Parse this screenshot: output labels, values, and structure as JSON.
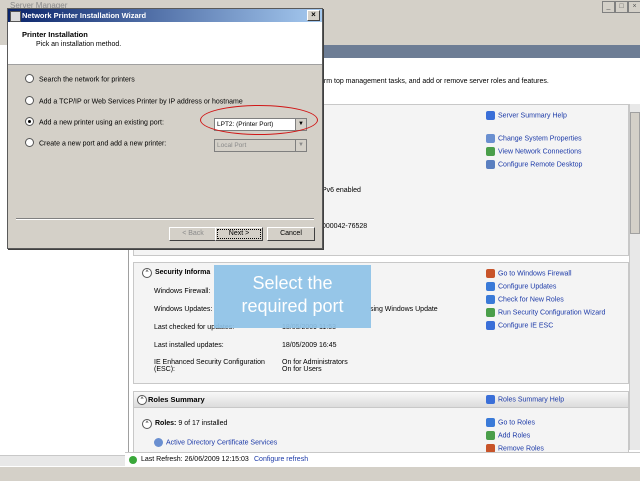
{
  "server_manager": {
    "window_title": "Server Manager",
    "intro_text": "orm top management tasks, and add or remove server roles and features.",
    "computer_info_fragments": {
      "ipv6": "Pv6 enabled",
      "product_id": "000042-76528"
    },
    "summary_links": {
      "help": "Server Summary Help",
      "items": [
        "Change System Properties",
        "View Network Connections",
        "Configure Remote Desktop"
      ]
    },
    "security": {
      "title": "Security Informa",
      "rows": [
        {
          "label": "Windows Firewall:",
          "value": ""
        },
        {
          "label": "Windows Updates:",
          "value": "sing Windows Update"
        },
        {
          "label": "Last checked for updates:",
          "value": "18/05/2009 11:53"
        },
        {
          "label": "Last installed updates:",
          "value": "18/05/2009 16:45"
        },
        {
          "label": "IE Enhanced Security Configuration (ESC):",
          "value": "On for Administrators On for Users"
        }
      ],
      "links": [
        "Go to Windows Firewall",
        "Configure Updates",
        "Check for New Roles",
        "Run Security Configuration Wizard",
        "Configure IE ESC"
      ]
    },
    "roles": {
      "title": "Roles Summary",
      "help": "Roles Summary Help",
      "count_label": "Roles:",
      "count_value": "9 of 17 installed",
      "first_role": "Active Directory Certificate Services",
      "links": [
        "Go to Roles",
        "Add Roles",
        "Remove Roles"
      ]
    },
    "status": {
      "last_refresh": "Last Refresh: 26/06/2009 12:15:03",
      "configure": "Configure refresh"
    }
  },
  "wizard": {
    "title": "Network Printer Installation Wizard",
    "header": "Printer Installation",
    "subheader": "Pick an installation method.",
    "options": [
      {
        "label": "Search the network for printers",
        "selected": false
      },
      {
        "label": "Add a TCP/IP or Web Services Printer by IP address or hostname",
        "selected": false
      },
      {
        "label": "Add a new printer using an existing port:",
        "selected": true
      },
      {
        "label": "Create a new port and add a new printer:",
        "selected": false
      }
    ],
    "existing_port": "LPT2: (Printer Port)",
    "new_port_type": "Local Port",
    "buttons": {
      "back": "< Back",
      "next": "Next >",
      "cancel": "Cancel"
    }
  },
  "callout": {
    "line1": "Select the",
    "line2": "required port",
    "color": "#8fc3e8"
  },
  "annotation_color": "#d01818"
}
